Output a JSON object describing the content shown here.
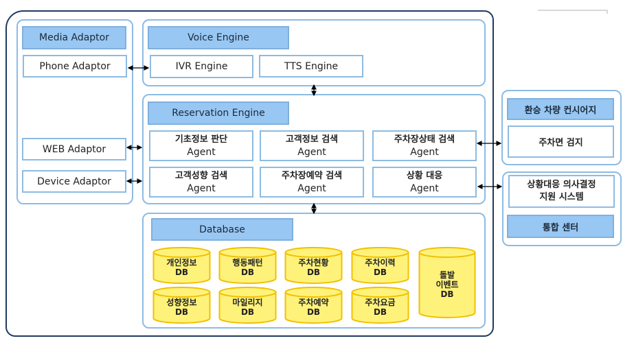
{
  "colors": {
    "header_fill": "#99c7f3",
    "panel_border": "#8dbbe3",
    "outer_border": "#1f3a5f",
    "db_fill": "#fff27a",
    "db_stroke": "#f0c000"
  },
  "media": {
    "header": "Media Adaptor",
    "phone": "Phone Adaptor",
    "web": "WEB Adaptor",
    "device": "Device Adaptor"
  },
  "voice": {
    "header": "Voice Engine",
    "ivr": "IVR Engine",
    "tts": "TTS Engine"
  },
  "reservation": {
    "header": "Reservation Engine",
    "agents": [
      {
        "name": "기초정보 판단",
        "sub": "Agent"
      },
      {
        "name": "고객정보 검색",
        "sub": "Agent"
      },
      {
        "name": "주차장상태 검색",
        "sub": "Agent"
      },
      {
        "name": "고객성향 검색",
        "sub": "Agent"
      },
      {
        "name": "주차장예약 검색",
        "sub": "Agent"
      },
      {
        "name": "상황 대응",
        "sub": "Agent"
      }
    ]
  },
  "database": {
    "header": "Database",
    "dbs": [
      {
        "name": "개인정보",
        "sub": "DB"
      },
      {
        "name": "행동패턴",
        "sub": "DB"
      },
      {
        "name": "주차현황",
        "sub": "DB"
      },
      {
        "name": "주차이력",
        "sub": "DB"
      },
      {
        "name": "성향정보",
        "sub": "DB"
      },
      {
        "name": "마일리지",
        "sub": "DB"
      },
      {
        "name": "주차예약",
        "sub": "DB"
      },
      {
        "name": "주차요금",
        "sub": "DB"
      },
      {
        "name": "돌발\n이벤트",
        "sub": "DB"
      }
    ]
  },
  "concierge": {
    "header": "환승 차량 컨시어지",
    "item": "주차면 검지"
  },
  "decision": {
    "item_line1": "상황대응 의사결정",
    "item_line2": "지원 시스템",
    "footer": "통합 센터"
  }
}
